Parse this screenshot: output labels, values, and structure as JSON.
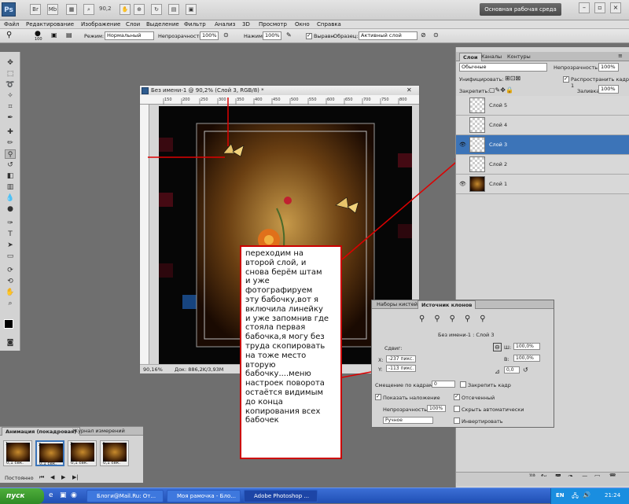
{
  "app": {
    "logo": "Ps",
    "zoom": "90,2",
    "workspace_button": "Основная рабочая среда",
    "window_controls": [
      "minimize-icon",
      "restore-icon",
      "close-icon"
    ]
  },
  "menus": [
    "Файл",
    "Редактирование",
    "Изображение",
    "Слои",
    "Выделение",
    "Фильтр",
    "Анализ",
    "3D",
    "Просмотр",
    "Окно",
    "Справка"
  ],
  "options": {
    "brush_size": "100",
    "mode_label": "Режим:",
    "mode_value": "Нормальный",
    "opacity_label": "Непрозрачность:",
    "opacity_value": "100%",
    "pressure_label": "Нажим:",
    "pressure_value": "100%",
    "aligned_label": "Выравн.",
    "sample_label": "Образец:",
    "sample_value": "Активный слой"
  },
  "document": {
    "title": "Без имени-1 @ 90,2% (Слой 3, RGB/8) *",
    "zoom_status": "90,16%",
    "doc_status": "Док: 886,2K/3,93M",
    "ruler_marks": [
      "150",
      "200",
      "250",
      "300",
      "350",
      "400",
      "450",
      "500",
      "550",
      "600",
      "650",
      "700",
      "750",
      "800"
    ]
  },
  "layers_panel": {
    "tabs": [
      "Слои",
      "Каналы",
      "Контуры"
    ],
    "blend_mode": "Обычные",
    "opacity_label": "Непрозрачность:",
    "opacity_value": "100%",
    "unify_label": "Унифицировать:",
    "propagate_label": "Распространить кадр 1",
    "lock_label": "Закрепить:",
    "fill_label": "Заливка:",
    "fill_value": "100%",
    "layers": [
      {
        "name": "Слой 5",
        "visible": false,
        "selected": false
      },
      {
        "name": "Слой 4",
        "visible": false,
        "selected": false
      },
      {
        "name": "Слой 3",
        "visible": true,
        "selected": true
      },
      {
        "name": "Слой 2",
        "visible": false,
        "selected": false
      },
      {
        "name": "Слой 1",
        "visible": true,
        "selected": false
      }
    ]
  },
  "clone_panel": {
    "tabs": [
      "Наборы кистей",
      "Источник клонов"
    ],
    "source_name": "Без имени-1 : Слой 3",
    "offset_label": "Сдвиг:",
    "x_label": "X:",
    "x_value": "-237 пикс.",
    "y_label": "Y:",
    "y_value": "-113 пикс.",
    "w_label": "Ш:",
    "w_value": "100,0%",
    "h_label": "В:",
    "h_value": "100,0%",
    "angle_value": "0,0",
    "frame_offset_label": "Смещение по кадрам:",
    "frame_offset_value": "0",
    "lock_frame_label": "Закрепить кадр",
    "show_overlay_label": "Показать наложение",
    "opacity_label": "Непрозрачность:",
    "opacity_value": "100%",
    "clipped_label": "Отсеченный",
    "auto_hide_label": "Скрыть автоматически",
    "invert_label": "Инвертировать",
    "blend_value": "Ручное"
  },
  "annotation": {
    "lines": [
      "переходим на",
      "второй слой, и",
      "снова берём штам",
      "и уже",
      "фотографируем",
      "эту бабочку,вот я",
      "включила линейку",
      "и уже запомнив где",
      "стояла первая",
      "бабочка,я могу  без",
      "труда скопировать",
      "на тоже место",
      "вторую",
      "бабочку....меню",
      "настроек поворота",
      "остаётся видимым",
      "до конца",
      "копирования всех",
      "бабочек"
    ],
    "color": "#cc0000"
  },
  "animation_panel": {
    "tabs": [
      "Анимация (покадровая)",
      "Журнал измерений"
    ],
    "frames": [
      {
        "number": "1",
        "delay": "0,1 сек."
      },
      {
        "number": "2",
        "delay": "0,1 сек."
      },
      {
        "number": "3",
        "delay": "0,1 сек."
      },
      {
        "number": "4",
        "delay": "0,1 сек."
      }
    ],
    "loop_value": "Постоянно"
  },
  "taskbar": {
    "start_label": "пуск",
    "tasks": [
      "Блоги@Mail.Ru: От...",
      "Моя рамочка - Бло...",
      "Adobe Photoshop ..."
    ],
    "language": "EN",
    "time": "21:24"
  }
}
